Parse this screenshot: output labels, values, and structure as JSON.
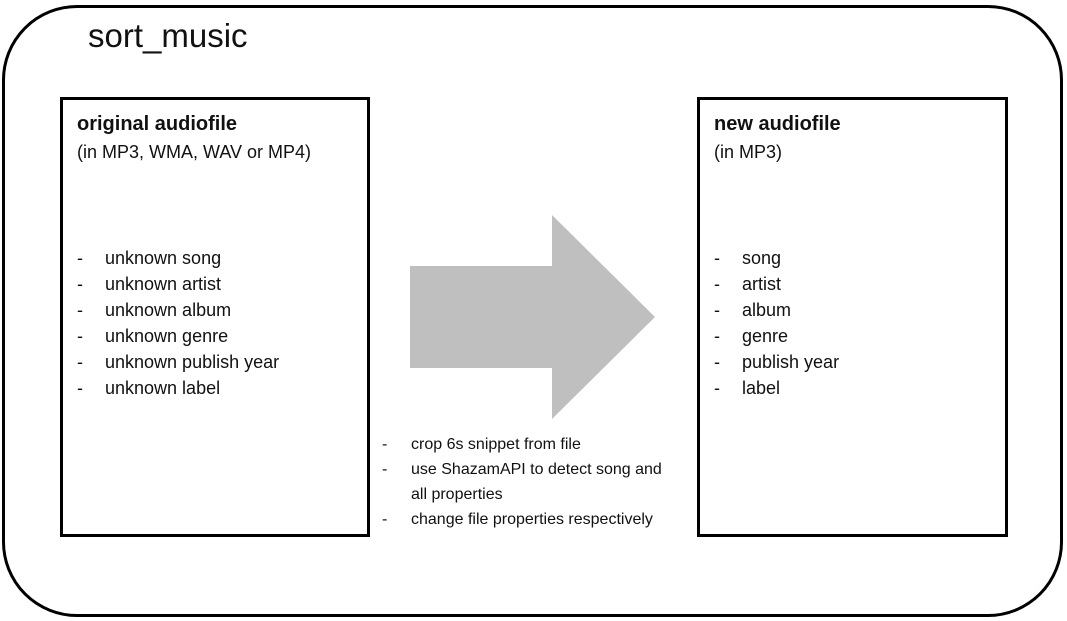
{
  "title": "sort_music",
  "original": {
    "title": "original audiofile",
    "subtitle": "(in MP3, WMA, WAV or MP4)",
    "properties": [
      "unknown song",
      "unknown artist",
      "unknown album",
      "unknown genre",
      "unknown publish year",
      "unknown label"
    ]
  },
  "new": {
    "title": "new audiofile",
    "subtitle": "(in MP3)",
    "properties": [
      "song",
      "artist",
      "album",
      "genre",
      "publish year",
      "label"
    ]
  },
  "bullet": "-",
  "steps": [
    "crop 6s snippet from file",
    "use ShazamAPI to detect song and all properties",
    "change file properties respectively"
  ],
  "colors": {
    "arrow": "#bfbfbf",
    "border": "#000000"
  },
  "icons": {
    "arrow": "right-arrow-icon"
  }
}
